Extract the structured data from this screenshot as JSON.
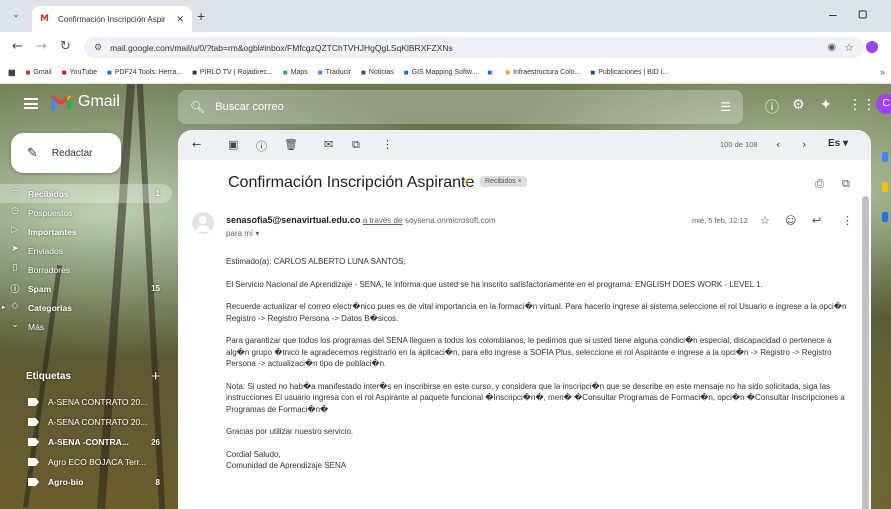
{
  "browser": {
    "tab_title": "Confirmación Inscripción Aspir",
    "url": "mail.google.com/mail/u/0/?tab=rm&ogbl#inbox/FMfcgzQZTChTVHJHgQgLSqKlBRXFZXNs",
    "bookmarks": [
      {
        "label": "Gmail",
        "icon": "gmail-icon",
        "color": "#d93025"
      },
      {
        "label": "YouTube",
        "icon": "youtube-icon",
        "color": "#ff0000"
      },
      {
        "label": "PDF24 Tools: Herra...",
        "icon": "pdf24-icon",
        "color": "#2d6bb5"
      },
      {
        "label": "PIRLO TV | Rojadirec...",
        "icon": "pirlo-icon",
        "color": "#333333"
      },
      {
        "label": "Maps",
        "icon": "maps-icon",
        "color": "#34a853"
      },
      {
        "label": "Traducir",
        "icon": "translate-icon",
        "color": "#4285f4"
      },
      {
        "label": "Noticias",
        "icon": "news-icon",
        "color": "#4a4a4a"
      },
      {
        "label": "GIS Mapping Softw...",
        "icon": "esri-icon",
        "color": "#0079c1"
      },
      {
        "label": "",
        "icon": "chrome-store-icon",
        "color": "#1a73e8"
      },
      {
        "label": "Infraestructura Colo...",
        "icon": "infra-icon",
        "color": "#e8a33d"
      },
      {
        "label": "Publicaciones | BID I...",
        "icon": "bid-icon",
        "color": "#1b4b8f"
      }
    ],
    "bookmarks_more": "»"
  },
  "gmail": {
    "app_name": "Gmail",
    "search_placeholder": "Buscar correo",
    "compose_label": "Redactar",
    "nav": [
      {
        "label": "Recibidos",
        "count": "1",
        "icon": "inbox-icon",
        "active": true
      },
      {
        "label": "Pospuestos",
        "count": "",
        "icon": "clock-icon"
      },
      {
        "label": "Importantes",
        "count": "",
        "icon": "important-icon",
        "bold": true
      },
      {
        "label": "Enviados",
        "count": "",
        "icon": "send-icon"
      },
      {
        "label": "Borradores",
        "count": "",
        "icon": "draft-icon"
      },
      {
        "label": "Spam",
        "count": "15",
        "icon": "spam-icon",
        "bold": true
      },
      {
        "label": "Categorías",
        "count": "",
        "icon": "categories-icon",
        "bold": true
      },
      {
        "label": "Más",
        "count": "",
        "icon": "chevron-down-icon"
      }
    ],
    "labels_heading": "Etiquetas",
    "labels": [
      {
        "label": "A-SENA CONTRATO 20...",
        "count": ""
      },
      {
        "label": "A-SENA CONTRATO 20...",
        "count": ""
      },
      {
        "label": "A-SENA -CONTRA...",
        "count": "26",
        "bold": true
      },
      {
        "label": "Agro ECO BOJACA Terr...",
        "count": ""
      },
      {
        "label": "Agro-bio",
        "count": "8",
        "bold": true
      }
    ],
    "toolbar": {
      "pager": "100 de 108",
      "lang": "Es"
    }
  },
  "email": {
    "subject": "Confirmación Inscripción Aspirante",
    "inbox_badge": "Recibidos ×",
    "sender_email": "senasofia5@senavirtual.edu.co",
    "via_text": "a través de",
    "via_domain": "soysena.onmicrosoft.com",
    "to_me": "para mí ▾",
    "date": "mié, 5 feb, 12:12",
    "paragraphs": [
      "Estimado(a): CARLOS ALBERTO  LUNA SANTOS,",
      "El Servicio Nacional de Aprendizaje - SENA, le informa que usted  se ha inscrito satisfactoriamente en el programa:  ENGLISH DOES WORK - LEVEL 1.",
      "Recuerde actualizar el correo electr�nico pues es de vital importancia en la formaci�n virtual. Para hacerlo ingrese al sistema seleccione el rol Usuario e ingrese a la opci�n  Registro -> Registro Persona -> Datos B�sicos.",
      "Para garantizar que todos los programas del SENA lleguen a todos los colombianos, le pedimos que si usted tiene alguna condici�n especial, discapacidad o pertenece a alg�n grupo �tnico le agradecemos registrarlo en la aplicaci�n, para ello ingrese a SOFIA Plus, seleccione el rol Aspirante e ingrese a la opci�n  -> Registro -> Registro Persona -> actualizaci�n tipo de poblaci�n.",
      "Nota: Si usted no hab�a manifestado inter�s en inscribirse en este curso, y considera que la inscripci�n que se describe en este mensaje no ha sido solicitada, siga las instrucciones  El usuario ingresa con el rol Aspirante al paquete funcional �Inscripci�n�, men� �Consultar Programas de Formaci�n, opci�n �Consultar Inscripciones a Programas de Formaci�n�",
      "Gracias por utilizar nuestro servicio.",
      "Cordial Saludo,\nComunidad de Aprendizaje SENA"
    ]
  },
  "colors": {
    "accent_red": "#d93025",
    "profile": "#a142f4",
    "star_label": "#f4b400"
  }
}
